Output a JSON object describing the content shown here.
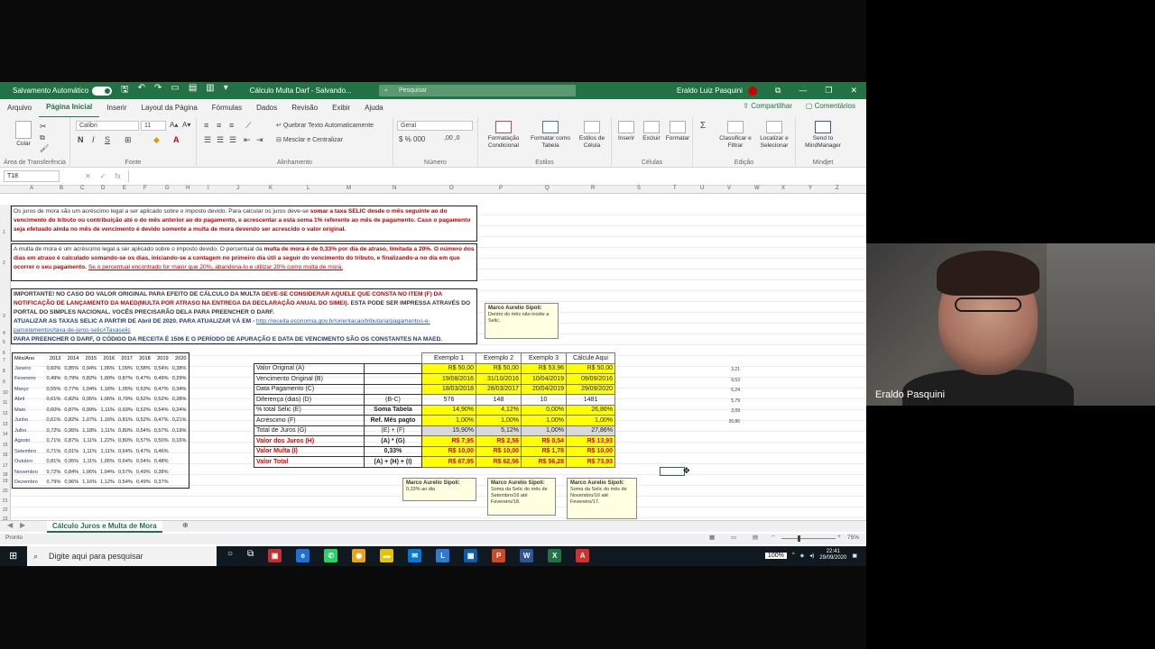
{
  "window": {
    "autosave_label": "Salvamento Automático",
    "doc_title": "Cálculo Multa Darf - Salvando...",
    "search_placeholder": "Pesquisar",
    "user": "Eraldo Luiz Pasquini"
  },
  "menu": {
    "tabs": [
      "Arquivo",
      "Página Inicial",
      "Inserir",
      "Layout da Página",
      "Fórmulas",
      "Dados",
      "Revisão",
      "Exibir",
      "Ajuda"
    ],
    "share": "Compartilhar",
    "comments": "Comentários"
  },
  "ribbon": {
    "paste": "Colar",
    "clipboard_group": "Área de Transferência",
    "font_name": "Calibri",
    "font_size": "11",
    "font_group": "Fonte",
    "wrap_text": "Quebrar Texto Automaticamente",
    "merge_center": "Mesclar e Centralizar",
    "alignment_group": "Alinhamento",
    "number_format": "Geral",
    "number_group": "Número",
    "conditional_format": "Formatação Condicional",
    "format_table": "Formatar como Tabela",
    "cell_styles": "Estilos de Célula",
    "styles_group": "Estilos",
    "insert": "Inserir",
    "delete": "Excluir",
    "format": "Formatar",
    "cells_group": "Células",
    "sort_filter": "Classificar e Filtrar",
    "find_select": "Localizar e Selecionar",
    "editing_group": "Edição",
    "send_mindmanager": "Send to MindManager",
    "mindjet_group": "Mindjet"
  },
  "formula_bar": {
    "name_box": "T18",
    "fx": "fx"
  },
  "columns": [
    "A",
    "B",
    "C",
    "D",
    "E",
    "F",
    "G",
    "H",
    "I",
    "J",
    "K",
    "L",
    "M",
    "N",
    "O",
    "P",
    "Q",
    "R",
    "S",
    "T",
    "U",
    "V",
    "W",
    "X",
    "Y",
    "Z"
  ],
  "notes": {
    "p1_a": "Os juros de mora são um acréscimo legal a ser aplicado sobre o imposto devido. Para calcular os juros deve-se",
    "p1_b": "somar a taxa SELIC desde o mês seguinte ao do vencimento do tributo ou contribuição até o do mês anterior ao do pagamento, e acrescentar a esta soma 1% referente ao mês de pagamento. Caso o pagamento seja efetuado ainda no mês de vencimento é devido somente a multa de mora devendo ser acrescido o valor original.",
    "p2_a": "A multa de mora é um acréscimo legal a ser aplicado sobre o imposto devido. O percentual da",
    "p2_b": "multa de mora é de 0,33% por dia de atraso, limitada a 20%. O número dos dias em atraso é calculado somando-se os dias, iniciando-se a contagem no primeiro dia útil a seguir do vencimento do tributo, e finalizando-a no dia em que ocorrer o seu pagamento.",
    "p2_c": "Se o percentual encontrado for maior que 20%, abandona-lo e utilizar 20% como multa de mora.",
    "p3_a": "IMPORTANTE! NO CASO DO VALOR ORIGINAL PARA EFEITO DE CÁLCULO DA MULTA",
    "p3_b": "DEVE-SE CONSIDERAR AQUELE QUE CONSTA NO ITEM (F) DA NOTIFICAÇÃO DE LANÇAMENTO DA MAED(MULTA POR ATRASO NA ENTREGA DA DECLARAÇÃO ANUAL DO SIMEI).",
    "p3_c": "ESTA PODE SER IMPRESSA ATRAVÉS DO PORTAL DO SIMPLES NACIONAL. VOCÊS PRECISARÃO DELA PARA PREENCHER O DARF.",
    "p4_a": "ATUALIZAR AS TAXAS SELIC A PARTIR DE Abril DE 2020. PARA ATUALIZAR VÁ EM -",
    "p4_b": "http://receita.economia.gov.br/orientacao/tributaria/pagamentos-e-parcelamentos/taxa-de-juros-selic#Taxaselic",
    "p5": "PARA PREENCHER O DARF, O CÓDIGO DA RECEITA É 1506 E O PERÍODO DE APURAÇÃO E DATA DE VENCIMENTO SÃO OS CONSTANTES NA MAED."
  },
  "selic": {
    "headers": [
      "Mês/Ano",
      "2013",
      "2014",
      "2015",
      "2016",
      "2017",
      "2018",
      "2019",
      "2020"
    ],
    "rows": [
      [
        "Janeiro",
        "0,60%",
        "0,85%",
        "0,94%",
        "1,06%",
        "1,09%",
        "0,58%",
        "0,54%",
        "0,38%"
      ],
      [
        "Fevereiro",
        "0,49%",
        "0,79%",
        "0,82%",
        "1,00%",
        "0,87%",
        "0,47%",
        "0,49%",
        "0,29%"
      ],
      [
        "Março",
        "0,55%",
        "0,77%",
        "1,04%",
        "1,16%",
        "1,05%",
        "0,53%",
        "0,47%",
        "0,34%"
      ],
      [
        "Abril",
        "0,61%",
        "0,82%",
        "0,95%",
        "1,06%",
        "0,79%",
        "0,52%",
        "0,52%",
        "0,28%"
      ],
      [
        "Maio",
        "0,60%",
        "0,87%",
        "0,99%",
        "1,11%",
        "0,93%",
        "0,52%",
        "0,54%",
        "0,24%"
      ],
      [
        "Junho",
        "0,61%",
        "0,82%",
        "1,07%",
        "1,16%",
        "0,81%",
        "0,52%",
        "0,47%",
        "0,21%"
      ],
      [
        "Julho",
        "0,72%",
        "0,95%",
        "1,18%",
        "1,11%",
        "0,80%",
        "0,54%",
        "0,57%",
        "0,19%"
      ],
      [
        "Agosto",
        "0,71%",
        "0,87%",
        "1,11%",
        "1,22%",
        "0,80%",
        "0,57%",
        "0,50%",
        "0,16%"
      ],
      [
        "Setembro",
        "0,71%",
        "0,91%",
        "1,11%",
        "1,11%",
        "0,64%",
        "0,47%",
        "0,46%",
        ""
      ],
      [
        "Outubro",
        "0,81%",
        "0,95%",
        "1,11%",
        "1,05%",
        "0,64%",
        "0,54%",
        "0,48%",
        ""
      ],
      [
        "Novembro",
        "0,72%",
        "0,84%",
        "1,06%",
        "1,04%",
        "0,57%",
        "0,49%",
        "0,38%",
        ""
      ],
      [
        "Dezembro",
        "0,79%",
        "0,96%",
        "1,16%",
        "1,12%",
        "0,54%",
        "0,49%",
        "0,37%",
        ""
      ]
    ]
  },
  "calc": {
    "headers": [
      "Exemplo 1",
      "Exemplo 2",
      "Exemplo 3",
      "Cálcule Aqui"
    ],
    "rows": [
      {
        "label": "Valor Original (A)",
        "formula": "",
        "vals": [
          "R$ 50,00",
          "R$ 50,00",
          "R$ 53,96",
          "R$ 50,00"
        ],
        "style": "y"
      },
      {
        "label": "Vencimento Original (B)",
        "formula": "",
        "vals": [
          "19/08/2016",
          "31/10/2016",
          "10/04/2019",
          "09/09/2016"
        ],
        "style": "y"
      },
      {
        "label": "Data Pagamento (C)",
        "formula": "",
        "vals": [
          "18/03/2018",
          "28/03/2017",
          "20/04/2019",
          "29/09/2020"
        ],
        "style": "y"
      },
      {
        "label": "Diferença (dias) (D)",
        "formula": "(B-C)",
        "vals": [
          "576",
          "148",
          "10",
          "1481"
        ],
        "style": ""
      },
      {
        "label": "% total Selic (E)",
        "formula": "Soma Tabela",
        "vals": [
          "14,90%",
          "4,12%",
          "0,00%",
          "26,86%"
        ],
        "style": "y"
      },
      {
        "label": "Acréscimo (F)",
        "formula": "Ref. Mês pagto",
        "vals": [
          "1,00%",
          "1,00%",
          "1,00%",
          "1,00%"
        ],
        "style": "y"
      },
      {
        "label": "Total de Juros (G)",
        "formula": "(E) + (F)",
        "vals": [
          "15,90%",
          "5,12%",
          "1,00%",
          "27,86%"
        ],
        "style": "g"
      },
      {
        "label": "Valor dos Juros (H)",
        "formula": "(A) * (G)",
        "vals": [
          "R$ 7,95",
          "R$ 2,56",
          "R$ 0,54",
          "R$ 13,93"
        ],
        "style": "r"
      },
      {
        "label": "Valor Multa (I)",
        "formula": "0,33%",
        "vals": [
          "R$ 10,00",
          "R$ 10,00",
          "R$ 1,78",
          "R$ 10,00"
        ],
        "style": "r"
      },
      {
        "label": "Valor Total",
        "formula": "(A) + (H) + (I)",
        "vals": [
          "R$ 67,95",
          "R$ 62,56",
          "R$ 56,28",
          "R$ 73,93"
        ],
        "style": "r"
      }
    ]
  },
  "side_values": [
    "3,21",
    "9,53",
    "6,24",
    "5,79",
    "2,09",
    "26,86"
  ],
  "comments": [
    {
      "author": "Marco Aurelio Sipoli:",
      "text": "Dentro do mês não incide a Selic."
    },
    {
      "author": "Marco Aurelio Sipoli:",
      "text": "0,33% ao dia"
    },
    {
      "author": "Marco Aurelio Sipoli:",
      "text": "Soma da Selic do mês de Setembro/16 até Fevereiro/18."
    },
    {
      "author": "Marco Aurelio Sipoli:",
      "text": "Soma da Selic do mês de Novembro/16 até Fevereiro/17."
    }
  ],
  "sheet_tab": "Cálculo Juros e Multa de Mora",
  "status": {
    "ready": "Pronto",
    "zoom": "75%"
  },
  "taskbar": {
    "search": "Digite aqui para pesquisar",
    "battery": "100%",
    "time": "22:41",
    "date": "29/09/2020"
  },
  "webcam": {
    "name": "Eraldo Pasquini"
  },
  "colors": {
    "excel_green": "#217346",
    "highlight_yellow": "#ffff00",
    "alert_red": "#c00000"
  }
}
